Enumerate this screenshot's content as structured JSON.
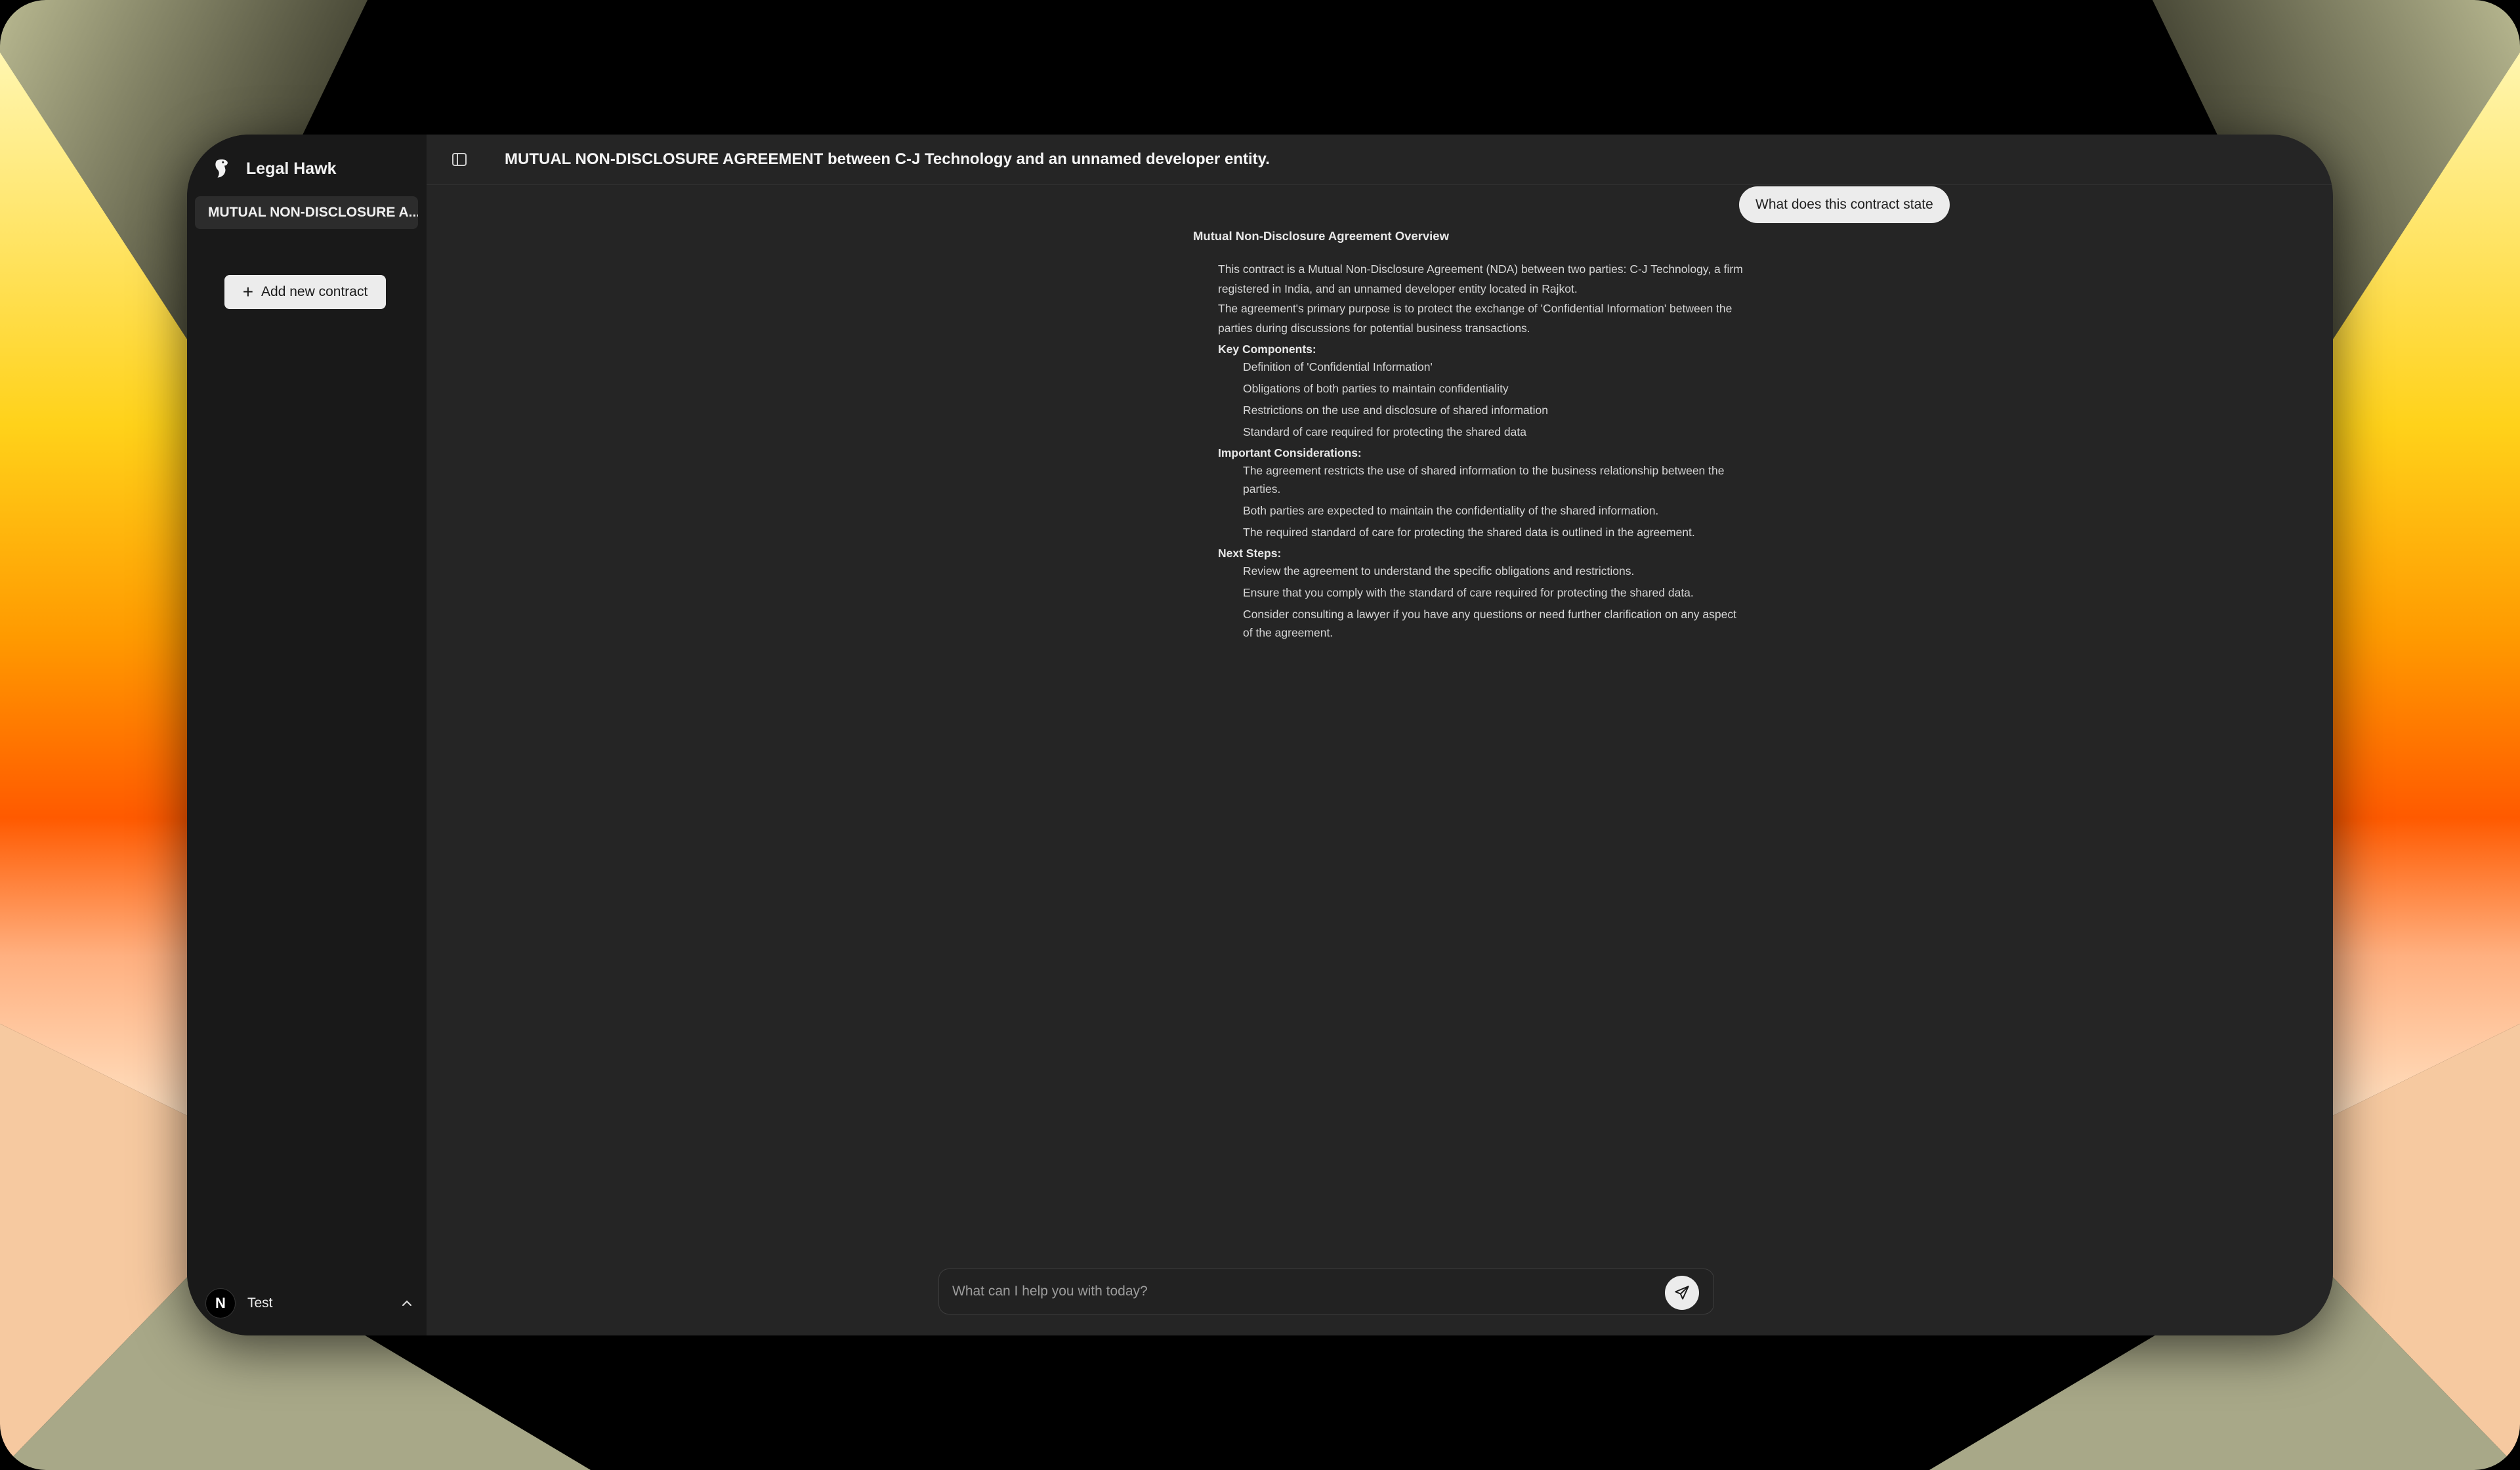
{
  "app": {
    "name": "Legal Hawk"
  },
  "sidebar": {
    "contracts": [
      "MUTUAL NON-DISCLOSURE A..."
    ],
    "add_contract_label": "Add new contract",
    "user": {
      "initial": "N",
      "name": "Test"
    }
  },
  "header": {
    "title": "MUTUAL NON-DISCLOSURE AGREEMENT between C-J Technology and an unnamed developer entity."
  },
  "chat": {
    "user_message": "What does this contract state",
    "answer": {
      "heading": "Mutual Non-Disclosure Agreement Overview",
      "para1": "This contract is a Mutual Non-Disclosure Agreement (NDA) between two parties: C-J Technology, a firm registered in India, and an unnamed developer entity located in Rajkot.",
      "para2": "The agreement's primary purpose is to protect the exchange of 'Confidential Information' between the parties during discussions for potential business transactions.",
      "sections": [
        {
          "title": "Key Components:",
          "items": [
            "Definition of 'Confidential Information'",
            "Obligations of both parties to maintain confidentiality",
            "Restrictions on the use and disclosure of shared information",
            "Standard of care required for protecting the shared data"
          ]
        },
        {
          "title": "Important Considerations:",
          "items": [
            "The agreement restricts the use of shared information to the business relationship between the parties.",
            "Both parties are expected to maintain the confidentiality of the shared information.",
            "The required standard of care for protecting the shared data is outlined in the agreement."
          ]
        },
        {
          "title": "Next Steps:",
          "items": [
            "Review the agreement to understand the specific obligations and restrictions.",
            "Ensure that you comply with the standard of care required for protecting the shared data.",
            "Consider consulting a lawyer if you have any questions or need further clarification on any aspect of the agreement."
          ]
        }
      ]
    }
  },
  "composer": {
    "placeholder": "What can I help you with today?",
    "value": ""
  },
  "icons": {
    "logo": "hawk-logo-icon",
    "sidebar_toggle": "sidebar-toggle-icon",
    "add": "plus-icon",
    "chevron": "chevron-up-icon",
    "send": "send-icon"
  },
  "colors": {
    "window_bg": "#252525",
    "sidebar_bg": "#191919",
    "accent_button": "#ececec"
  }
}
